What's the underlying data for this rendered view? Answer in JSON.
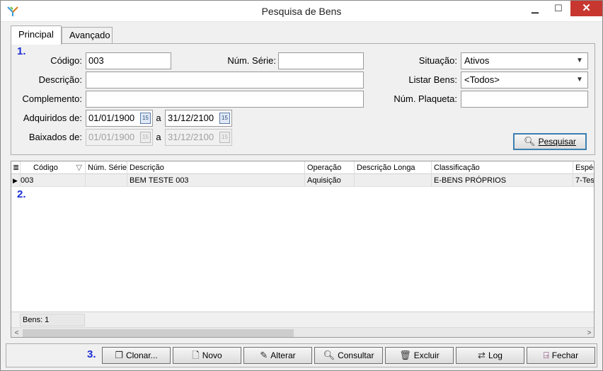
{
  "window": {
    "title": "Pesquisa de Bens",
    "minimize": "▁",
    "maximize": "☐",
    "close": "✕",
    "accent": "#c7372f"
  },
  "tabs": [
    {
      "label": "Principal",
      "active": true
    },
    {
      "label": "Avançado",
      "active": false
    }
  ],
  "markers": {
    "one": "1.",
    "two": "2.",
    "three": "3.",
    "color": "#1a2fd4"
  },
  "form": {
    "codigo_label": "Código:",
    "codigo_value": "003",
    "num_serie_label": "Núm. Série:",
    "num_serie_value": "",
    "situacao_label": "Situação:",
    "situacao_value": "Ativos",
    "descricao_label": "Descrição:",
    "descricao_value": "",
    "listar_bens_label": "Listar Bens:",
    "listar_bens_value": "<Todos>",
    "complemento_label": "Complemento:",
    "complemento_value": "",
    "num_plaqueta_label": "Núm. Plaqueta:",
    "num_plaqueta_value": "",
    "adquiridos_label": "Adquiridos de:",
    "adquiridos_from": "01/01/1900",
    "adquiridos_to": "31/12/2100",
    "baixados_label": "Baixados de:",
    "baixados_from": "01/01/1900",
    "baixados_to": "31/12/2100",
    "a_label": "a",
    "cal_icon_text": "15",
    "pesquisar_label": "Pesquisar"
  },
  "grid": {
    "columns": [
      "Código",
      "Núm. Série",
      "Descrição",
      "Operação",
      "Descrição Longa",
      "Classificação",
      "Espéc"
    ],
    "rows": [
      [
        "003",
        "",
        "BEM TESTE 003",
        "Aquisição",
        "",
        "E-BENS PRÓPRIOS",
        "7-Tes"
      ]
    ],
    "count_label": "Bens: 1",
    "row_marker": "▶",
    "header_icon": "≣",
    "sort_icon": "▽"
  },
  "actions": [
    {
      "label": "Clonar...",
      "icon": "clone-icon"
    },
    {
      "label": "Novo",
      "icon": "new-document-icon"
    },
    {
      "label": "Alterar",
      "icon": "edit-icon"
    },
    {
      "label": "Consultar",
      "icon": "search-icon"
    },
    {
      "label": "Excluir",
      "icon": "trash-icon"
    },
    {
      "label": "Log",
      "icon": "log-icon"
    },
    {
      "label": "Fechar",
      "icon": "exit-door-icon"
    }
  ]
}
